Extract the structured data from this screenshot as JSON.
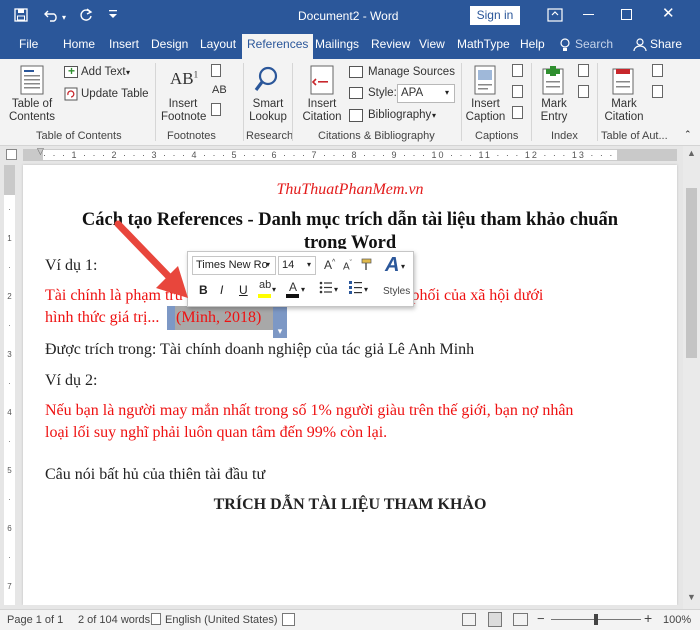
{
  "titlebar": {
    "doc_title": "Document2  -  Word",
    "signin": "Sign in"
  },
  "tabs": [
    {
      "label": "File"
    },
    {
      "label": "Home"
    },
    {
      "label": "Insert"
    },
    {
      "label": "Design"
    },
    {
      "label": "Layout"
    },
    {
      "label": "References"
    },
    {
      "label": "Mailings"
    },
    {
      "label": "Review"
    },
    {
      "label": "View"
    },
    {
      "label": "MathType"
    },
    {
      "label": "Help"
    }
  ],
  "search": {
    "label": "Search"
  },
  "share": {
    "label": "Share"
  },
  "ribbon": {
    "toc": {
      "button": "Table of\nContents",
      "add_text": "Add Text",
      "update_table": "Update Table",
      "group": "Table of Contents"
    },
    "footnotes": {
      "insert_footnote": "Insert\nFootnote",
      "group": "Footnotes"
    },
    "research": {
      "smart_lookup": "Smart\nLookup",
      "group": "Research"
    },
    "citations": {
      "insert_citation": "Insert\nCitation",
      "manage_sources": "Manage Sources",
      "style_label": "Style:",
      "style_value": "APA",
      "bibliography": "Bibliography",
      "group": "Citations & Bibliography"
    },
    "captions": {
      "insert_caption": "Insert\nCaption",
      "group": "Captions"
    },
    "index": {
      "mark_entry": "Mark\nEntry",
      "group": "Index"
    },
    "toa": {
      "mark_citation": "Mark\nCitation",
      "group": "Table of Aut..."
    }
  },
  "document": {
    "site": "ThuThuatPhanMem.vn",
    "heading_line1": "Cách tạo References - Danh mục trích dẫn tài liệu tham khảo chuẩn",
    "heading_line2": "trong Word",
    "example1": "Ví dụ 1:",
    "para1_line1": "Tài chính là phạm trù kinh tế phản ánh các quan hệ phân phối của xã hội dưới",
    "para1_line2": "hình thức giá trị...",
    "citation": "(Minh, 2018)",
    "para2": "Được trích trong: Tài chính doanh nghiệp của tác giả Lê Anh Minh",
    "example2": "Ví dụ 2:",
    "para3_line1": "Nếu bạn là người may mắn nhất trong số 1% người giàu trên thế giới, bạn nợ nhân",
    "para3_line2": "loại lối suy nghĩ phải luôn quan tâm đến 99% còn lại.",
    "para4": "Câu nói bất hủ của thiên tài đầu tư",
    "refs_heading": "TRÍCH DẪN TÀI LIỆU THAM KHẢO"
  },
  "mini_toolbar": {
    "font": "Times New Ro",
    "size": "14",
    "bold": "B",
    "italic": "I",
    "underline": "U",
    "styles": "Styles"
  },
  "status": {
    "page": "Page 1 of 1",
    "words": "2 of 104 words",
    "language": "English (United States)",
    "zoom": "100%"
  },
  "colors": {
    "brand": "#2b579a",
    "red_text": "#ee1111",
    "site_red": "#e31b1b",
    "arrow": "#e8463c"
  }
}
